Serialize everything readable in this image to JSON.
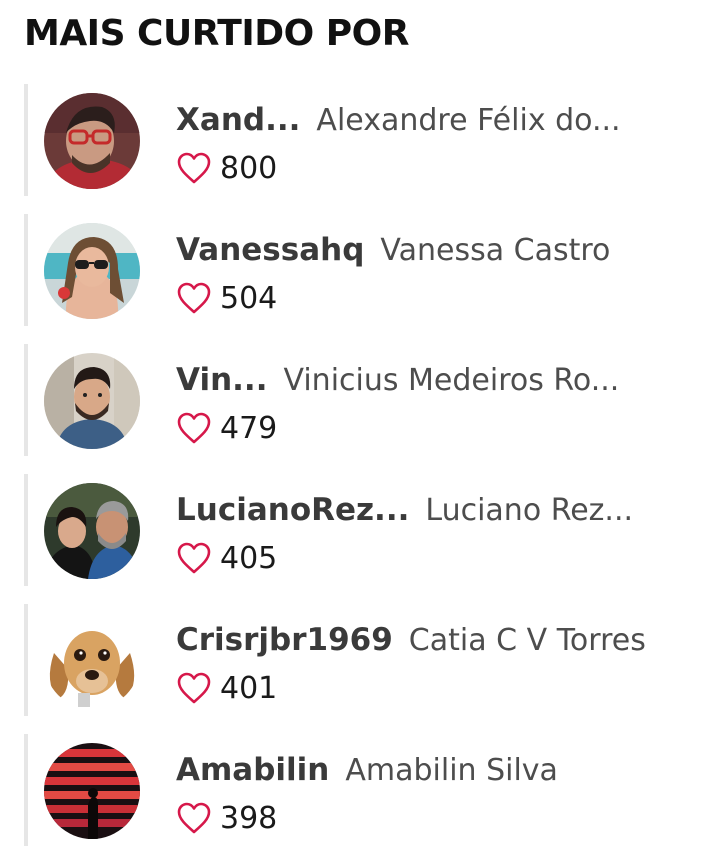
{
  "section": {
    "title": "MAIS CURTIDO POR"
  },
  "accent_color": "#d6184a",
  "users": [
    {
      "username": "Xand...",
      "full_name": "Alexandre Félix do...",
      "likes": "800",
      "avatar": "bearded-man-glasses-photo"
    },
    {
      "username": "Vanessahq",
      "full_name": "Vanessa Castro",
      "likes": "504",
      "avatar": "woman-sunglasses-pool-photo"
    },
    {
      "username": "Vin...",
      "full_name": "Vinicius Medeiros Ro...",
      "likes": "479",
      "avatar": "bearded-man-photo"
    },
    {
      "username": "LucianoRez...",
      "full_name": "Luciano Rez...",
      "likes": "405",
      "avatar": "couple-photo"
    },
    {
      "username": "Crisrjbr1969",
      "full_name": "Catia C V Torres",
      "likes": "401",
      "avatar": "cocker-spaniel-dog-photo"
    },
    {
      "username": "Amabilin",
      "full_name": "Amabilin Silva",
      "likes": "398",
      "avatar": "stage-silhouette-photo"
    }
  ]
}
